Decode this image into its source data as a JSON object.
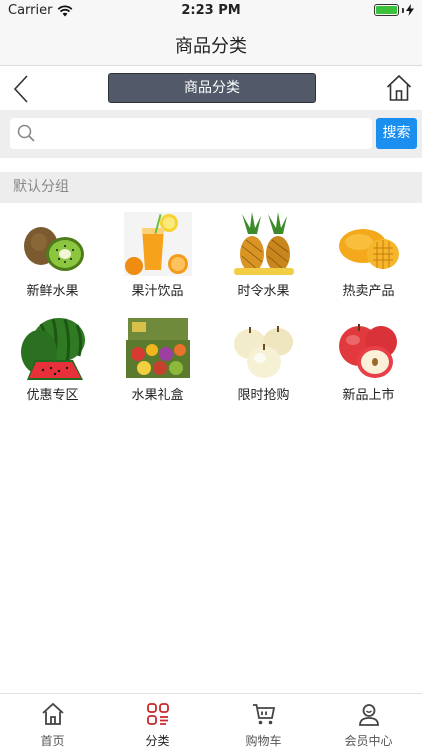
{
  "status_bar": {
    "carrier": "Carrier",
    "time": "2:23 PM"
  },
  "title_bar": {
    "title": "商品分类"
  },
  "nav": {
    "pill_label": "商品分类"
  },
  "search": {
    "value": "",
    "placeholder": "",
    "button_label": "搜索"
  },
  "group": {
    "title": "默认分组"
  },
  "categories": [
    {
      "label": "新鲜水果",
      "icon": "kiwi-image"
    },
    {
      "label": "果汁饮品",
      "icon": "juice-image"
    },
    {
      "label": "时令水果",
      "icon": "pineapple-image"
    },
    {
      "label": "热卖产品",
      "icon": "mango-image"
    },
    {
      "label": "优惠专区",
      "icon": "watermelon-image"
    },
    {
      "label": "水果礼盒",
      "icon": "gift-box-image"
    },
    {
      "label": "限时抢购",
      "icon": "pear-image"
    },
    {
      "label": "新品上市",
      "icon": "apple-image"
    }
  ],
  "tab_bar": {
    "active": 1,
    "accent_color": "#c8282d",
    "tabs": [
      {
        "label": "首页",
        "icon": "home-icon"
      },
      {
        "label": "分类",
        "icon": "category-icon"
      },
      {
        "label": "购物车",
        "icon": "cart-icon"
      },
      {
        "label": "会员中心",
        "icon": "user-icon"
      }
    ]
  }
}
